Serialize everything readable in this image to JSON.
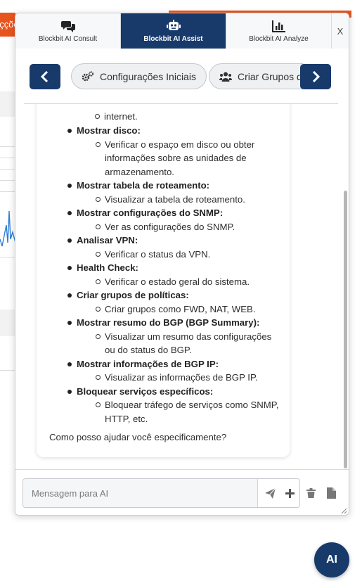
{
  "background": {
    "partial_tab_text": "eçções"
  },
  "tabs": [
    {
      "label": "Blockbit AI Consult",
      "icon": "chat-bubbles-icon"
    },
    {
      "label": "Blockbit AI Assist",
      "icon": "robot-icon"
    },
    {
      "label": "Blockbit AI Analyze",
      "icon": "bar-chart-icon"
    }
  ],
  "close_label": "X",
  "chips": [
    {
      "label": "Configurações Iniciais",
      "icon": "gears-icon"
    },
    {
      "label": "Criar Grupos de",
      "icon": "users-icon"
    }
  ],
  "message": {
    "cut_line": "internet.",
    "items": [
      {
        "title": "Mostrar disco:",
        "desc": "Verificar o espaço em disco ou obter informações sobre as unidades de armazenamento."
      },
      {
        "title": "Mostrar tabela de roteamento:",
        "desc": "Visualizar a tabela de roteamento."
      },
      {
        "title": "Mostrar configurações do SNMP:",
        "desc": "Ver as configurações do SNMP."
      },
      {
        "title": "Analisar VPN:",
        "desc": "Verificar o status da VPN."
      },
      {
        "title": "Health Check:",
        "desc": "Verificar o estado geral do sistema."
      },
      {
        "title": "Criar grupos de políticas:",
        "desc": "Criar grupos como FWD, NAT, WEB."
      },
      {
        "title": "Mostrar resumo do BGP (BGP Summary):",
        "desc": "Visualizar um resumo das configurações ou do status do BGP."
      },
      {
        "title": "Mostrar informações de BGP IP:",
        "desc": "Visualizar as informações de BGP IP."
      },
      {
        "title": "Bloquear serviços específicos:",
        "desc": "Bloquear tráfego de serviços como SNMP, HTTP, etc."
      }
    ],
    "closing": "Como posso ajudar você especificamente?"
  },
  "input": {
    "placeholder": "Mensagem para AI",
    "value": ""
  },
  "fab_label": "AI",
  "colors": {
    "brand": "#173a6b",
    "accent_orange": "#e8541e"
  }
}
